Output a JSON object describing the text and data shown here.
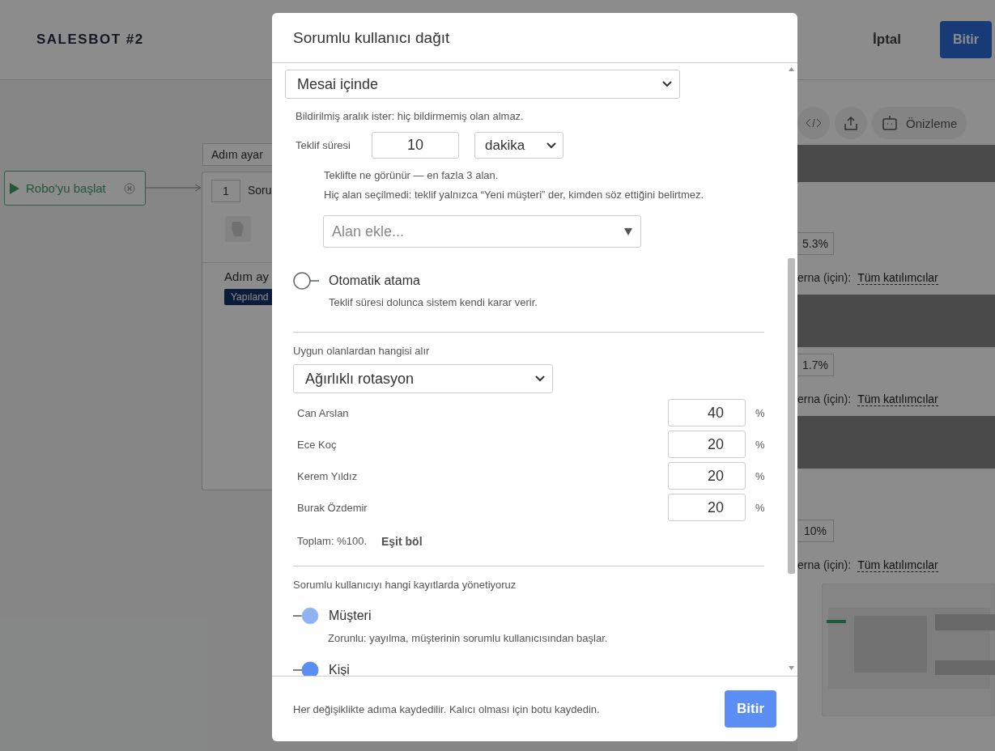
{
  "app": {
    "title": "SALESBOT #2",
    "cancel": "İptal",
    "finish": "Bitir"
  },
  "canvas": {
    "start_node": "Robo'yu başlat",
    "step_tooltip": "Adım ayar",
    "step": {
      "number": "1",
      "title": "Soru",
      "subtitle": "Adım ay",
      "badge": "Yapıland"
    }
  },
  "side_panel": {
    "preview": "Önizleme",
    "rows": [
      {
        "share": "5.3%",
        "audience_label": "erna (için):",
        "audience": "Tüm katılımcılar"
      },
      {
        "share": "1.7%",
        "audience_label": "erna (için):",
        "audience": "Tüm katılımcılar"
      },
      {
        "share": "10%",
        "audience_label": "erna (için):",
        "audience": "Tüm katılımcılar"
      }
    ]
  },
  "modal": {
    "title": "Sorumlu kullanıcı dağıt",
    "schedule": {
      "value": "Mesai içinde",
      "note": "Bildirilmiş aralık ister: hiç bildirmemiş olan almaz."
    },
    "offer": {
      "label": "Teklif süresi",
      "value": "10",
      "unit": "dakika",
      "notes": [
        "Teklifte ne görünür — en fazla 3 alan.",
        "Hiç alan seçilmedi: teklif yalnızca “Yeni müşteri” der, kimden söz ettiğini belirtmez."
      ],
      "placeholder": "Alan ekle..."
    },
    "auto_assign": {
      "label": "Otomatik atama",
      "note": "Teklif süresi dolunca sistem kendi karar verir.",
      "on": false
    },
    "rotation": {
      "label": "Uygun olanlardan hangisi alır",
      "value": "Ağırlıklı rotasyon",
      "weights": [
        {
          "name": "Can Arslan",
          "value": "40",
          "unit": "%"
        },
        {
          "name": "Ece Koç",
          "value": "20",
          "unit": "%"
        },
        {
          "name": "Kerem Yıldız",
          "value": "20",
          "unit": "%"
        },
        {
          "name": "Burak Özdemir",
          "value": "20",
          "unit": "%"
        }
      ],
      "total": "Toplam: %100.",
      "equalize": "Eşit böl"
    },
    "records": {
      "label": "Sorumlu kullanıcıyı hangi kayıtlarda yönetiyoruz",
      "options": [
        {
          "label": "Müşteri",
          "note": "Zorunlu: yayılma, müşterinin sorumlu kullanıcısından başlar.",
          "on": true,
          "disabled": true
        },
        {
          "label": "Kişi",
          "on": true,
          "disabled": false
        }
      ]
    },
    "footer": {
      "note": "Her değişiklikte adıma kaydedilir. Kalıcı olması için botu kaydedin.",
      "button": "Bitir"
    }
  }
}
